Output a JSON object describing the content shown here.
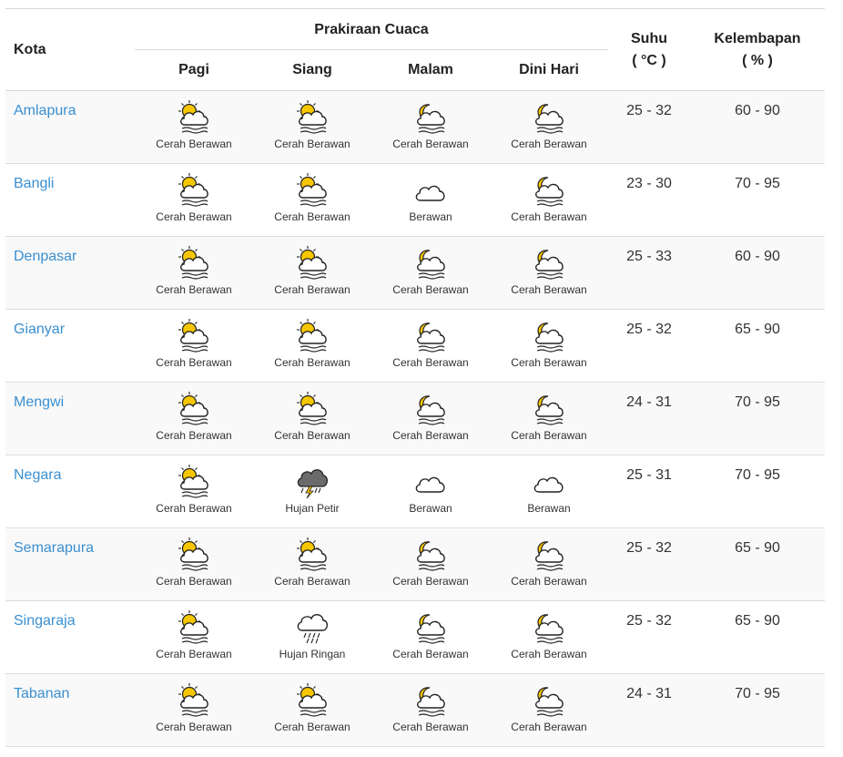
{
  "header": {
    "kota": "Kota",
    "forecast_group": "Prakiraan Cuaca",
    "times": [
      "Pagi",
      "Siang",
      "Malam",
      "Dini Hari"
    ],
    "suhu_label": "Suhu",
    "suhu_unit": "( °C )",
    "hum_label": "Kelembapan",
    "hum_unit": "( % )"
  },
  "colors": {
    "link": "#3a8fd0",
    "sun": "#f6c600",
    "moon": "#f6c600",
    "cloud_stroke": "#222222",
    "storm_cloud": "#6b6b6b"
  },
  "rows": [
    {
      "city": "Amlapura",
      "pagi": {
        "icon": "sun-cloud-icon",
        "label": "Cerah Berawan"
      },
      "siang": {
        "icon": "sun-cloud-icon",
        "label": "Cerah Berawan"
      },
      "malam": {
        "icon": "moon-cloud-icon",
        "label": "Cerah Berawan"
      },
      "dini": {
        "icon": "moon-cloud-icon",
        "label": "Cerah Berawan"
      },
      "suhu": "25 - 32",
      "hum": "60 - 90"
    },
    {
      "city": "Bangli",
      "pagi": {
        "icon": "sun-cloud-icon",
        "label": "Cerah Berawan"
      },
      "siang": {
        "icon": "sun-cloud-icon",
        "label": "Cerah Berawan"
      },
      "malam": {
        "icon": "cloud-icon",
        "label": "Berawan"
      },
      "dini": {
        "icon": "moon-cloud-icon",
        "label": "Cerah Berawan"
      },
      "suhu": "23 - 30",
      "hum": "70 - 95"
    },
    {
      "city": "Denpasar",
      "pagi": {
        "icon": "sun-cloud-icon",
        "label": "Cerah Berawan"
      },
      "siang": {
        "icon": "sun-cloud-icon",
        "label": "Cerah Berawan"
      },
      "malam": {
        "icon": "moon-cloud-icon",
        "label": "Cerah Berawan"
      },
      "dini": {
        "icon": "moon-cloud-icon",
        "label": "Cerah Berawan"
      },
      "suhu": "25 - 33",
      "hum": "60 - 90"
    },
    {
      "city": "Gianyar",
      "pagi": {
        "icon": "sun-cloud-icon",
        "label": "Cerah Berawan"
      },
      "siang": {
        "icon": "sun-cloud-icon",
        "label": "Cerah Berawan"
      },
      "malam": {
        "icon": "moon-cloud-icon",
        "label": "Cerah Berawan"
      },
      "dini": {
        "icon": "moon-cloud-icon",
        "label": "Cerah Berawan"
      },
      "suhu": "25 - 32",
      "hum": "65 - 90"
    },
    {
      "city": "Mengwi",
      "pagi": {
        "icon": "sun-cloud-icon",
        "label": "Cerah Berawan"
      },
      "siang": {
        "icon": "sun-cloud-icon",
        "label": "Cerah Berawan"
      },
      "malam": {
        "icon": "moon-cloud-icon",
        "label": "Cerah Berawan"
      },
      "dini": {
        "icon": "moon-cloud-icon",
        "label": "Cerah Berawan"
      },
      "suhu": "24 - 31",
      "hum": "70 - 95"
    },
    {
      "city": "Negara",
      "pagi": {
        "icon": "sun-cloud-icon",
        "label": "Cerah Berawan"
      },
      "siang": {
        "icon": "thunderstorm-icon",
        "label": "Hujan Petir"
      },
      "malam": {
        "icon": "cloud-icon",
        "label": "Berawan"
      },
      "dini": {
        "icon": "cloud-icon",
        "label": "Berawan"
      },
      "suhu": "25 - 31",
      "hum": "70 - 95"
    },
    {
      "city": "Semarapura",
      "pagi": {
        "icon": "sun-cloud-icon",
        "label": "Cerah Berawan"
      },
      "siang": {
        "icon": "sun-cloud-icon",
        "label": "Cerah Berawan"
      },
      "malam": {
        "icon": "moon-cloud-icon",
        "label": "Cerah Berawan"
      },
      "dini": {
        "icon": "moon-cloud-icon",
        "label": "Cerah Berawan"
      },
      "suhu": "25 - 32",
      "hum": "65 - 90"
    },
    {
      "city": "Singaraja",
      "pagi": {
        "icon": "sun-cloud-icon",
        "label": "Cerah Berawan"
      },
      "siang": {
        "icon": "rain-cloud-icon",
        "label": "Hujan Ringan"
      },
      "malam": {
        "icon": "moon-cloud-icon",
        "label": "Cerah Berawan"
      },
      "dini": {
        "icon": "moon-cloud-icon",
        "label": "Cerah Berawan"
      },
      "suhu": "25 - 32",
      "hum": "65 - 90"
    },
    {
      "city": "Tabanan",
      "pagi": {
        "icon": "sun-cloud-icon",
        "label": "Cerah Berawan"
      },
      "siang": {
        "icon": "sun-cloud-icon",
        "label": "Cerah Berawan"
      },
      "malam": {
        "icon": "moon-cloud-icon",
        "label": "Cerah Berawan"
      },
      "dini": {
        "icon": "moon-cloud-icon",
        "label": "Cerah Berawan"
      },
      "suhu": "24 - 31",
      "hum": "70 - 95"
    }
  ]
}
